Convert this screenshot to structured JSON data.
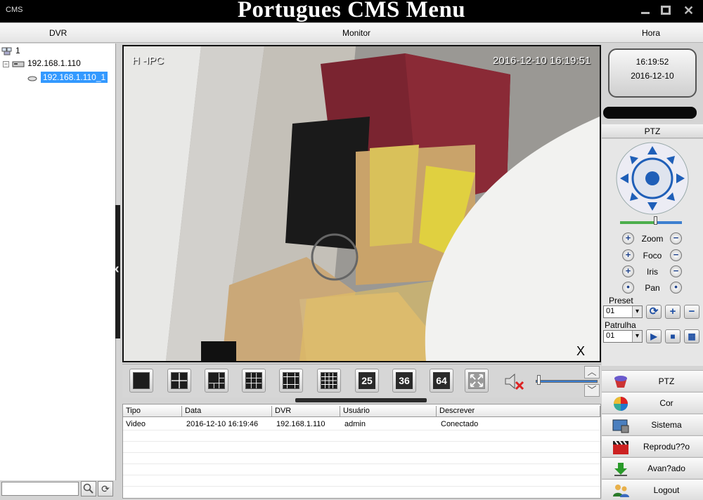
{
  "window": {
    "app_name": "CMS",
    "overlay_title": "Portugues CMS Menu"
  },
  "menu": {
    "dvr": "DVR",
    "monitor": "Monitor",
    "hora": "Hora"
  },
  "tree": {
    "root": "1",
    "host": "192.168.1.110",
    "device": "192.168.1.110_1"
  },
  "video": {
    "osd_name": "H  -IPC",
    "osd_time": "2016-12-10  16:19:51",
    "close_label": "X"
  },
  "layout_buttons": [
    "25",
    "36",
    "64"
  ],
  "log": {
    "columns": [
      "Tipo",
      "Data",
      "DVR",
      "Usuário",
      "Descrever"
    ],
    "rows": [
      [
        "Video",
        "2016-12-10 16:19:46",
        "192.168.1.110",
        "admin",
        "Conectado"
      ]
    ]
  },
  "clock": {
    "time": "16:19:52",
    "date": "2016-12-10"
  },
  "ptz": {
    "header": "PTZ",
    "controls": [
      "Zoom",
      "Foco",
      "Iris",
      "Pan"
    ],
    "preset_label": "Preset",
    "preset_value": "01",
    "patrol_label": "Patrulha",
    "patrol_value": "01"
  },
  "right_menu": [
    "PTZ",
    "Cor",
    "Sistema",
    "Reprodu??o",
    "Avan?ado",
    "Logout"
  ],
  "colors": {
    "accent_blue": "#1f5fb8",
    "selection": "#3399ff",
    "titlebar": "#000000"
  }
}
